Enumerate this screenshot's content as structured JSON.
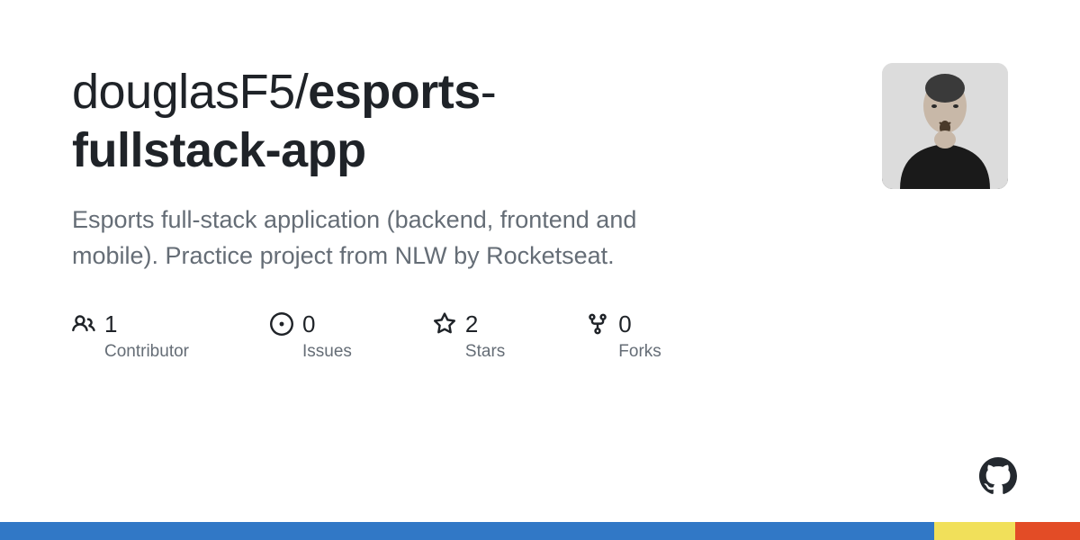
{
  "repo": {
    "owner": "douglasF5",
    "name_part1": "esports",
    "name_part2": "fullstack-app"
  },
  "description": "Esports full-stack application (backend, frontend and mobile). Practice project from NLW by Rocketseat.",
  "stats": {
    "contributors": {
      "count": "1",
      "label": "Contributor"
    },
    "issues": {
      "count": "0",
      "label": "Issues"
    },
    "stars": {
      "count": "2",
      "label": "Stars"
    },
    "forks": {
      "count": "0",
      "label": "Forks"
    }
  },
  "language_bar": [
    {
      "color": "#3178c6",
      "percent": 86.5
    },
    {
      "color": "#f1e05a",
      "percent": 7.5
    },
    {
      "color": "#e34c26",
      "percent": 6.0
    }
  ]
}
